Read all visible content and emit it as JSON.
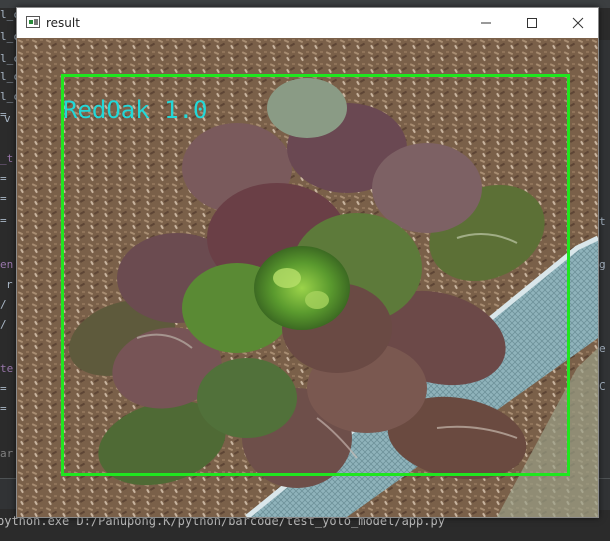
{
  "window": {
    "title": "result",
    "controls": {
      "minimize_icon": "minimize-icon",
      "maximize_icon": "maximize-icon",
      "close_icon": "close-icon"
    }
  },
  "detection": {
    "label": "RedOak",
    "confidence": "1.0",
    "label_text": "RedOak 1.0",
    "box_color": "#1fe61f",
    "label_color": "#22d8d8"
  },
  "background_ide": {
    "left_gutter_fragments": [
      "l_c",
      "l_c",
      "l_c",
      "l_c",
      "l_c",
      "= ",
      "v",
      "_t",
      "=",
      "=",
      "= ",
      "en",
      "r",
      "/",
      "/",
      "te",
      "=",
      "=",
      "ar"
    ],
    "right_gutter_fragments": [
      "t",
      "g",
      "e",
      "C"
    ],
    "console_text": "python.exe D:/Panupong.K/python/barcode/test_yolo_model/app.py"
  }
}
